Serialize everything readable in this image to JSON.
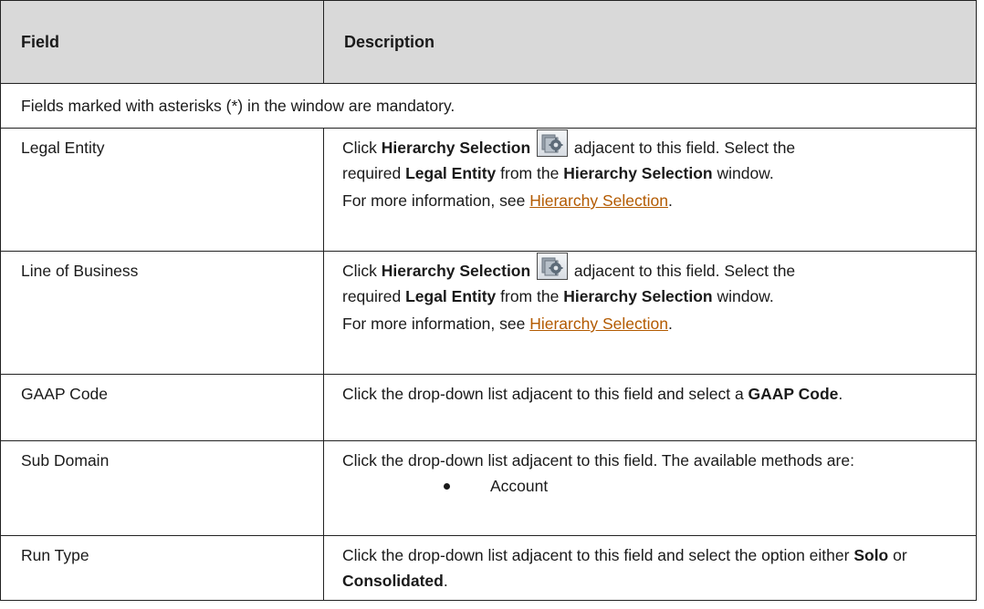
{
  "table": {
    "headers": {
      "field": "Field",
      "description": "Description"
    },
    "note": "Fields marked with asterisks (*) in the window are mandatory.",
    "rows": {
      "legal_entity": {
        "field": "Legal Entity",
        "line1_pre": "Click ",
        "line1_bold": "Hierarchy Selection",
        "line1_post": " adjacent to this field. Select the",
        "line2_pre": "required ",
        "line2_bold1": "Legal Entity",
        "line2_mid": " from the ",
        "line2_bold2": "Hierarchy Selection",
        "line2_post": " window.",
        "info_pre": "For more information, see ",
        "info_link": "Hierarchy Selection",
        "info_post": "."
      },
      "line_of_business": {
        "field": "Line of Business",
        "line1_pre": "Click ",
        "line1_bold": "Hierarchy Selection",
        "line1_post": " adjacent to this field. Select the",
        "line2_pre": "required ",
        "line2_bold1": "Legal Entity",
        "line2_mid": " from the ",
        "line2_bold2": "Hierarchy Selection",
        "line2_post": " window.",
        "info_pre": "For more information, see ",
        "info_link": "Hierarchy Selection",
        "info_post": "."
      },
      "gaap_code": {
        "field": "GAAP Code",
        "pre": "Click the drop-down list adjacent to this field and select a ",
        "bold": "GAAP Code",
        "post": "."
      },
      "sub_domain": {
        "field": "Sub Domain",
        "text": "Click the drop-down list adjacent to this field. The available methods are:",
        "options": [
          "Account"
        ]
      },
      "run_type": {
        "field": "Run Type",
        "pre": "Click the drop-down list adjacent to this field and select the option either ",
        "bold1": "Solo",
        "mid": " or ",
        "bold2": "Consolidated",
        "post": "."
      }
    }
  },
  "icons": {
    "hierarchy_selection": "hierarchy-selection-icon"
  }
}
